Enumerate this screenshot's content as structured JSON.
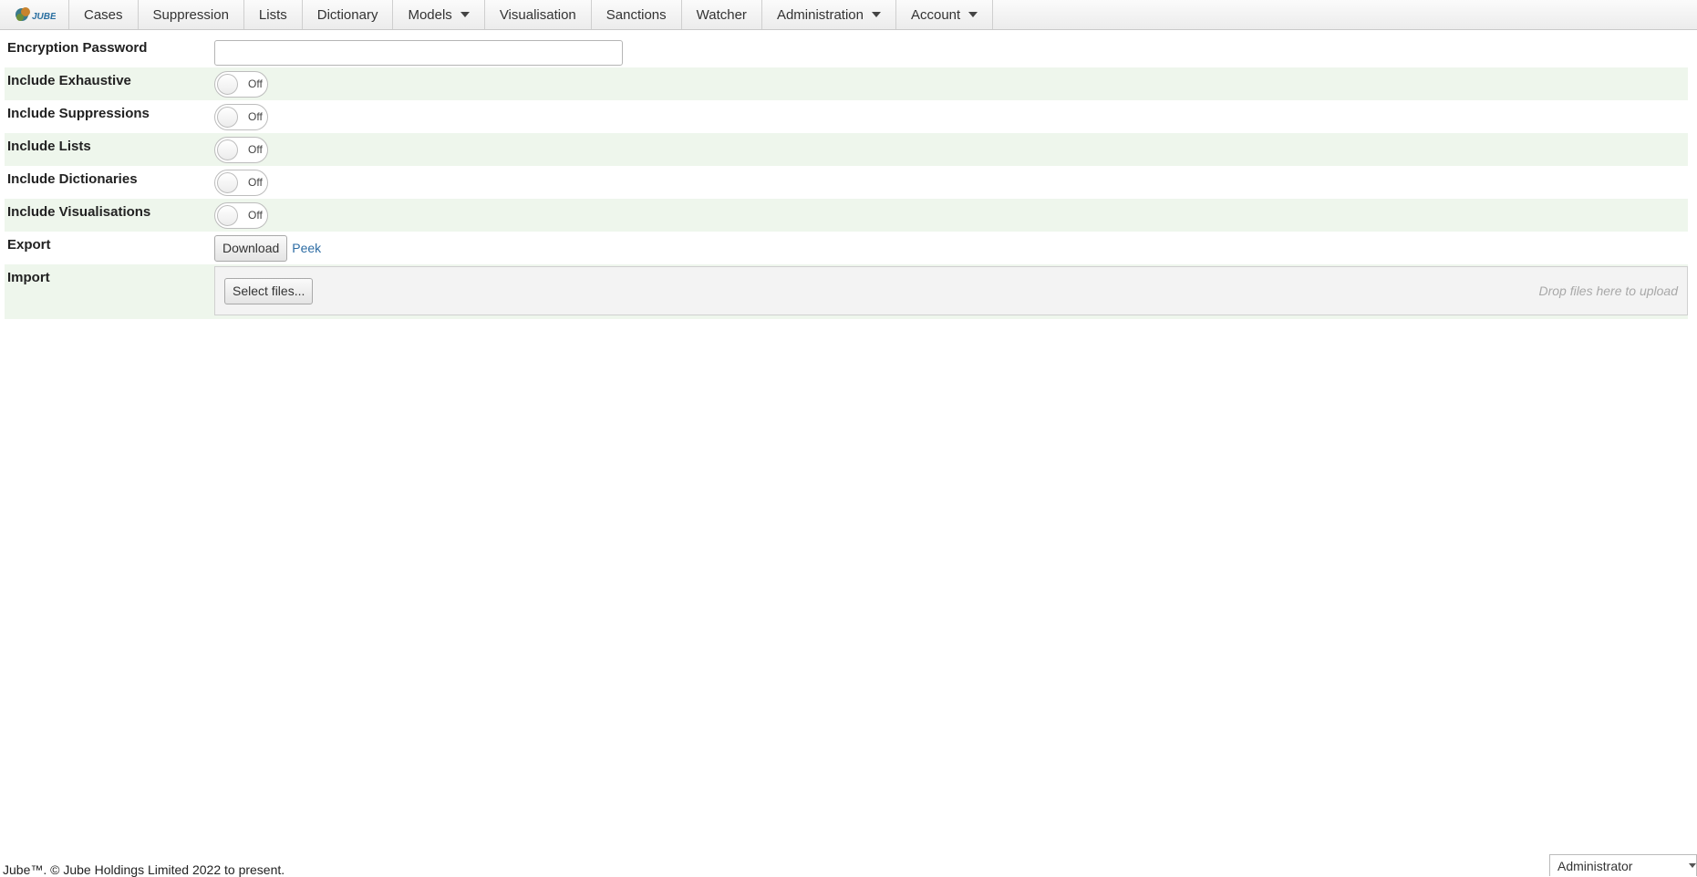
{
  "nav": {
    "logo_text": "JUBE",
    "items": [
      {
        "label": "Cases",
        "dropdown": false
      },
      {
        "label": "Suppression",
        "dropdown": false
      },
      {
        "label": "Lists",
        "dropdown": false
      },
      {
        "label": "Dictionary",
        "dropdown": false
      },
      {
        "label": "Models",
        "dropdown": true
      },
      {
        "label": "Visualisation",
        "dropdown": false
      },
      {
        "label": "Sanctions",
        "dropdown": false
      },
      {
        "label": "Watcher",
        "dropdown": false
      },
      {
        "label": "Administration",
        "dropdown": true
      },
      {
        "label": "Account",
        "dropdown": true
      }
    ]
  },
  "form": {
    "encryption_password": {
      "label": "Encryption Password",
      "value": ""
    },
    "toggles": [
      {
        "label": "Include Exhaustive",
        "state": "Off"
      },
      {
        "label": "Include Suppressions",
        "state": "Off"
      },
      {
        "label": "Include Lists",
        "state": "Off"
      },
      {
        "label": "Include Dictionaries",
        "state": "Off"
      },
      {
        "label": "Include Visualisations",
        "state": "Off"
      }
    ],
    "export": {
      "label": "Export",
      "download_button": "Download",
      "peek_link": "Peek"
    },
    "import": {
      "label": "Import",
      "select_button": "Select files...",
      "drop_hint": "Drop files here to upload"
    }
  },
  "footer": {
    "text": "Jube™. © Jube Holdings Limited 2022 to present."
  },
  "user_menu": {
    "selected": "Administrator"
  },
  "colors": {
    "alt_row": "#eef6ec",
    "link": "#2e6da4"
  }
}
